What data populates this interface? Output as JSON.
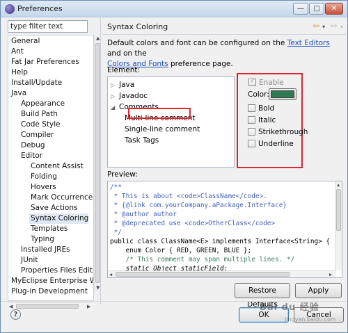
{
  "window": {
    "title": "Preferences",
    "minimize": "—",
    "maximize": "□",
    "close": "✕"
  },
  "filter": {
    "placeholder": "type filter text",
    "value": "type filter text"
  },
  "tree": [
    {
      "label": "General",
      "depth": 0
    },
    {
      "label": "Ant",
      "depth": 0
    },
    {
      "label": "Fat Jar Preferences",
      "depth": 0
    },
    {
      "label": "Help",
      "depth": 0
    },
    {
      "label": "Install/Update",
      "depth": 0
    },
    {
      "label": "Java",
      "depth": 0
    },
    {
      "label": "Appearance",
      "depth": 1
    },
    {
      "label": "Build Path",
      "depth": 1
    },
    {
      "label": "Code Style",
      "depth": 1
    },
    {
      "label": "Compiler",
      "depth": 1
    },
    {
      "label": "Debug",
      "depth": 1
    },
    {
      "label": "Editor",
      "depth": 1
    },
    {
      "label": "Content Assist",
      "depth": 2
    },
    {
      "label": "Folding",
      "depth": 2
    },
    {
      "label": "Hovers",
      "depth": 2
    },
    {
      "label": "Mark Occurrences",
      "depth": 2
    },
    {
      "label": "Save Actions",
      "depth": 2
    },
    {
      "label": "Syntax Coloring",
      "depth": 2,
      "selected": true
    },
    {
      "label": "Templates",
      "depth": 2
    },
    {
      "label": "Typing",
      "depth": 2
    },
    {
      "label": "Installed JREs",
      "depth": 1
    },
    {
      "label": "JUnit",
      "depth": 1
    },
    {
      "label": "Properties Files Editor",
      "depth": 1
    },
    {
      "label": "MyEclipse Enterprise Workbench",
      "depth": 0
    },
    {
      "label": "Plug-in Development",
      "depth": 0
    }
  ],
  "page": {
    "title": "Syntax Coloring",
    "desc_prefix": "Default colors and font can be configured on the ",
    "link1": "Text Editors",
    "desc_middle": " and on the",
    "link2": "Colors and Fonts",
    "desc_suffix": " preference page.",
    "element_label": "Element:",
    "preview_label": "Preview:"
  },
  "elements": [
    {
      "label": "Java",
      "twisty": "▷",
      "depth": 0
    },
    {
      "label": "Javadoc",
      "twisty": "▷",
      "depth": 0
    },
    {
      "label": "Comments",
      "twisty": "◢",
      "depth": 0
    },
    {
      "label": "Multi-line comment",
      "twisty": "",
      "depth": 1,
      "highlighted": true
    },
    {
      "label": "Single-line comment",
      "twisty": "",
      "depth": 1
    },
    {
      "label": "Task Tags",
      "twisty": "",
      "depth": 1
    }
  ],
  "options": {
    "enable": "Enable",
    "color_label": "Color:",
    "color_value": "#2f7a52",
    "styles": [
      "Bold",
      "Italic",
      "Strikethrough",
      "Underline"
    ]
  },
  "preview_lines": [
    "/**",
    " * This is about <code>ClassName</code>.",
    " * {@link com.yourCompany.aPackage.Interface}",
    " * @author author",
    " * @deprecated use <code>OtherClass</code>",
    " */",
    "public class ClassName<E> implements Interface<String> {",
    "    enum Color { RED, GREEN, BLUE };",
    "    /* This comment may span multiple lines. */",
    "    static Object staticField;"
  ],
  "buttons": {
    "restore": "Restore Defaults",
    "apply": "Apply",
    "ok": "OK",
    "cancel": "Cancel"
  },
  "help": "?",
  "watermark": "Bai du 经验",
  "watermark_sub": "jingyan.baidu.com",
  "colors": {
    "annotation": "#e1232e",
    "link": "#1a4fc4",
    "javadoc": "#3f5fbf",
    "keyword": "#7f0055",
    "comment": "#3f7f5f"
  }
}
